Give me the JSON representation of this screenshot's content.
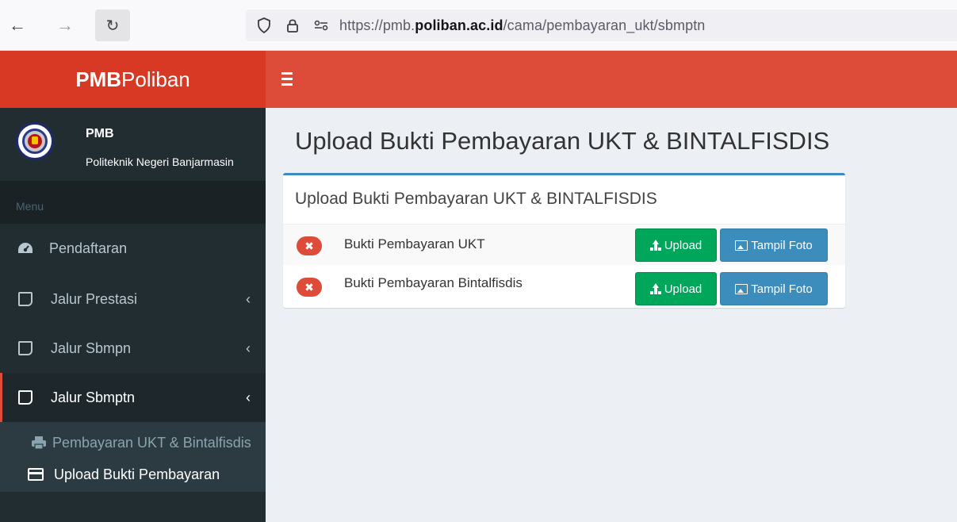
{
  "browser": {
    "url_prefix": "https://pmb.",
    "url_domain": "poliban.ac.id",
    "url_path": "/cama/pembayaran_ukt/sbmptn"
  },
  "header": {
    "logo_bold": "PMB",
    "logo_light": "Poliban"
  },
  "user_panel": {
    "name": "PMB",
    "subtitle": "Politeknik Negeri Banjarmasin"
  },
  "sidebar": {
    "menu_header": "Menu",
    "items": [
      {
        "label": "Pendaftaran",
        "icon": "dashboard-icon"
      },
      {
        "label": "Jalur Prestasi",
        "icon": "square-icon"
      },
      {
        "label": "Jalur Sbmpn",
        "icon": "square-icon"
      },
      {
        "label": "Jalur Sbmptn",
        "icon": "square-icon"
      }
    ],
    "sub_items": [
      {
        "label": "Pembayaran UKT & Bintalfisdis",
        "icon": "print-icon"
      },
      {
        "label": "Upload Bukti Pembayaran",
        "icon": "credit-card-icon"
      }
    ]
  },
  "content": {
    "page_title": "Upload Bukti Pembayaran UKT & BINTALFISDIS",
    "box_title": "Upload Bukti Pembayaran UKT & BINTALFISDIS",
    "rows": [
      {
        "label": "Bukti Pembayaran UKT",
        "upload_label": "Upload",
        "view_label": "Tampil Foto"
      },
      {
        "label": "Bukti Pembayaran Bintalfisdis",
        "upload_label": "Upload",
        "view_label": "Tampil Foto"
      }
    ]
  },
  "colors": {
    "header_red": "#dd4b39",
    "logo_red": "#d73925",
    "sidebar_dark": "#222d32",
    "box_border_blue": "#3c8dbc",
    "success_green": "#00a65a"
  }
}
